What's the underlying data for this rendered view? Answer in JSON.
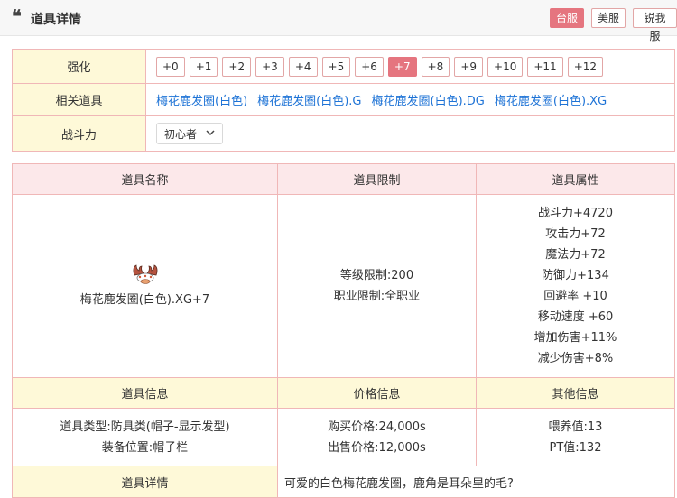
{
  "header": {
    "title": "道具详情",
    "servers": [
      {
        "label": "台服",
        "active": true
      },
      {
        "label": "美服",
        "active": false
      },
      {
        "label": "锐我服",
        "active": false
      }
    ]
  },
  "enhance": {
    "label": "强化",
    "levels": [
      "+0",
      "+1",
      "+2",
      "+3",
      "+4",
      "+5",
      "+6",
      "+7",
      "+8",
      "+9",
      "+10",
      "+11",
      "+12"
    ],
    "selected": "+7"
  },
  "related": {
    "label": "相关道具",
    "items": [
      "梅花鹿发圈(白色)",
      "梅花鹿发圈(白色).G",
      "梅花鹿发圈(白色).DG",
      "梅花鹿发圈(白色).XG"
    ]
  },
  "power": {
    "label": "战斗力",
    "selected": "初心者"
  },
  "item_table": {
    "headers": {
      "name": "道具名称",
      "limit": "道具限制",
      "attributes": "道具属性"
    },
    "name": "梅花鹿发圈(白色).XG+7",
    "limits": [
      "等级限制:200",
      "职业限制:全职业"
    ],
    "attributes": [
      "战斗力+4720",
      "攻击力+72",
      "魔法力+72",
      "防御力+134",
      "回避率 +10",
      "移动速度 +60",
      "增加伤害+11%",
      "减少伤害+8%"
    ],
    "info_headers": {
      "item": "道具信息",
      "price": "价格信息",
      "other": "其他信息"
    },
    "item_info": [
      "道具类型:防具类(帽子-显示发型)",
      "装备位置:帽子栏"
    ],
    "price_info": [
      "购买价格:24,000s",
      "出售价格:12,000s"
    ],
    "other_info": [
      "喂养值:13",
      "PT值:132"
    ],
    "detail_label": "道具详情",
    "detail_text": "可爱的白色梅花鹿发圈，鹿角是耳朵里的毛?"
  },
  "colors": {
    "accent": "#e5757f",
    "border": "#f0b7b7",
    "head_pink": "#fce8ea",
    "head_yellow": "#fef9d8",
    "link": "#1e73d6"
  }
}
